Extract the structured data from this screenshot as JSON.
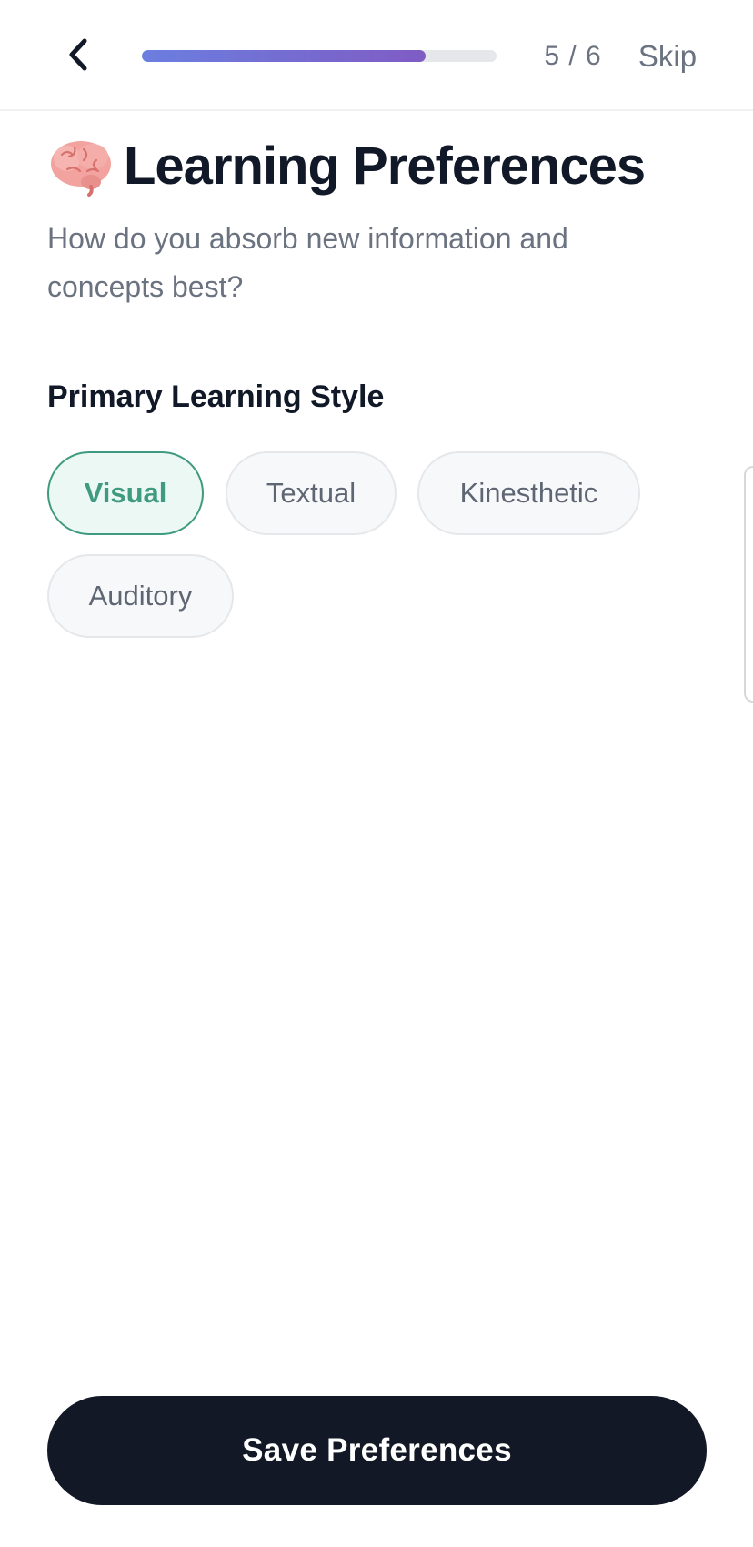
{
  "header": {
    "progress": 0.8,
    "step_counter": "5 / 6",
    "skip_label": "Skip",
    "progress_colors": [
      "#6b7ee0",
      "#7f5cc4"
    ]
  },
  "page": {
    "title_icon": "brain-icon",
    "title": "Learning Preferences",
    "subtitle": "How do you absorb new information and concepts best?"
  },
  "learning_style": {
    "label": "Primary Learning Style",
    "options": [
      {
        "label": "Visual",
        "selected": true
      },
      {
        "label": "Textual",
        "selected": false
      },
      {
        "label": "Kinesthetic",
        "selected": false
      },
      {
        "label": "Auditory",
        "selected": false
      }
    ],
    "accent_color": "#3f9a80"
  },
  "footer": {
    "save_label": "Save Preferences",
    "button_color": "#121826"
  }
}
